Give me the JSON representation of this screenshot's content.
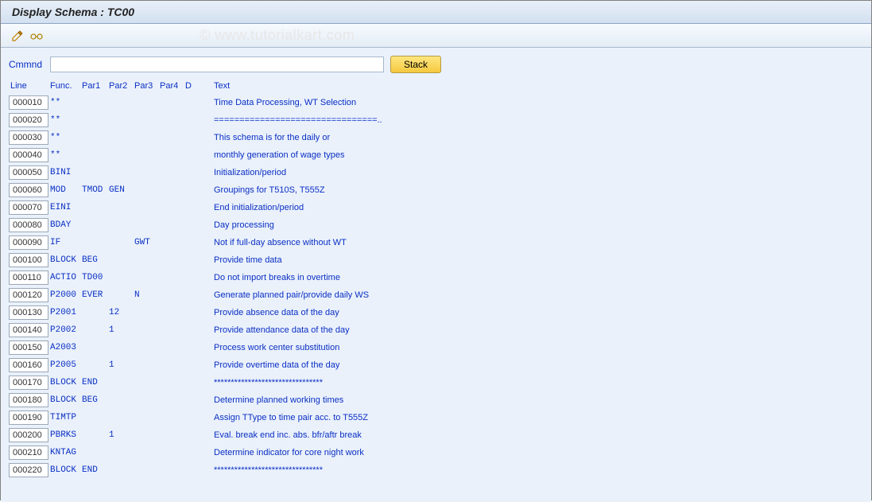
{
  "title": "Display Schema : TC00",
  "watermark": "© www.tutorialkart.com",
  "toolbar": {
    "icon1_name": "edit-pencil-icon",
    "icon2_name": "glasses-icon"
  },
  "command": {
    "label": "Cmmnd",
    "value": "",
    "stack_label": "Stack"
  },
  "headers": {
    "line": "Line",
    "func": "Func.",
    "par1": "Par1",
    "par2": "Par2",
    "par3": "Par3",
    "par4": "Par4",
    "d": "D",
    "text": "Text"
  },
  "rows": [
    {
      "line": "000010",
      "func": "**",
      "par1": "",
      "par2": "",
      "par3": "",
      "par4": "",
      "d": "",
      "text": "Time Data Processing, WT Selection"
    },
    {
      "line": "000020",
      "func": "**",
      "par1": "",
      "par2": "",
      "par3": "",
      "par4": "",
      "d": "",
      "text": "================================.."
    },
    {
      "line": "000030",
      "func": "**",
      "par1": "",
      "par2": "",
      "par3": "",
      "par4": "",
      "d": "",
      "text": "This schema is for the daily or"
    },
    {
      "line": "000040",
      "func": "**",
      "par1": "",
      "par2": "",
      "par3": "",
      "par4": "",
      "d": "",
      "text": "monthly generation of wage types"
    },
    {
      "line": "000050",
      "func": "BINI",
      "par1": "",
      "par2": "",
      "par3": "",
      "par4": "",
      "d": "",
      "text": "Initialization/period"
    },
    {
      "line": "000060",
      "func": "MOD",
      "par1": "TMOD",
      "par2": "GEN",
      "par3": "",
      "par4": "",
      "d": "",
      "text": "Groupings for T510S, T555Z"
    },
    {
      "line": "000070",
      "func": "EINI",
      "par1": "",
      "par2": "",
      "par3": "",
      "par4": "",
      "d": "",
      "text": "End initialization/period"
    },
    {
      "line": "000080",
      "func": "BDAY",
      "par1": "",
      "par2": "",
      "par3": "",
      "par4": "",
      "d": "",
      "text": "Day processing"
    },
    {
      "line": "000090",
      "func": "IF",
      "par1": "",
      "par2": "",
      "par3": "GWT",
      "par4": "",
      "d": "",
      "text": "Not if full-day absence without WT"
    },
    {
      "line": "000100",
      "func": "BLOCK",
      "par1": "BEG",
      "par2": "",
      "par3": "",
      "par4": "",
      "d": "",
      "text": "Provide time data"
    },
    {
      "line": "000110",
      "func": "ACTIO",
      "par1": "TD00",
      "par2": "",
      "par3": "",
      "par4": "",
      "d": "",
      "text": "Do not import breaks in overtime"
    },
    {
      "line": "000120",
      "func": "P2000",
      "par1": "EVER",
      "par2": "",
      "par3": "N",
      "par4": "",
      "d": "",
      "text": "Generate planned pair/provide daily WS"
    },
    {
      "line": "000130",
      "func": "P2001",
      "par1": "",
      "par2": "12",
      "par3": "",
      "par4": "",
      "d": "",
      "text": "Provide absence data of the day"
    },
    {
      "line": "000140",
      "func": "P2002",
      "par1": "",
      "par2": "1",
      "par3": "",
      "par4": "",
      "d": "",
      "text": "Provide attendance data of the day"
    },
    {
      "line": "000150",
      "func": "A2003",
      "par1": "",
      "par2": "",
      "par3": "",
      "par4": "",
      "d": "",
      "text": "Process work center substitution"
    },
    {
      "line": "000160",
      "func": "P2005",
      "par1": "",
      "par2": "1",
      "par3": "",
      "par4": "",
      "d": "",
      "text": "Provide overtime data of the day"
    },
    {
      "line": "000170",
      "func": "BLOCK",
      "par1": "END",
      "par2": "",
      "par3": "",
      "par4": "",
      "d": "",
      "text": "********************************"
    },
    {
      "line": "000180",
      "func": "BLOCK",
      "par1": "BEG",
      "par2": "",
      "par3": "",
      "par4": "",
      "d": "",
      "text": "Determine planned working times"
    },
    {
      "line": "000190",
      "func": "TIMTP",
      "par1": "",
      "par2": "",
      "par3": "",
      "par4": "",
      "d": "",
      "text": "Assign TType to time pair acc. to T555Z"
    },
    {
      "line": "000200",
      "func": "PBRKS",
      "par1": "",
      "par2": "1",
      "par3": "",
      "par4": "",
      "d": "",
      "text": "Eval. break end inc. abs. bfr/aftr break"
    },
    {
      "line": "000210",
      "func": "KNTAG",
      "par1": "",
      "par2": "",
      "par3": "",
      "par4": "",
      "d": "",
      "text": "Determine indicator for core night work"
    },
    {
      "line": "000220",
      "func": "BLOCK",
      "par1": "END",
      "par2": "",
      "par3": "",
      "par4": "",
      "d": "",
      "text": "********************************"
    }
  ]
}
